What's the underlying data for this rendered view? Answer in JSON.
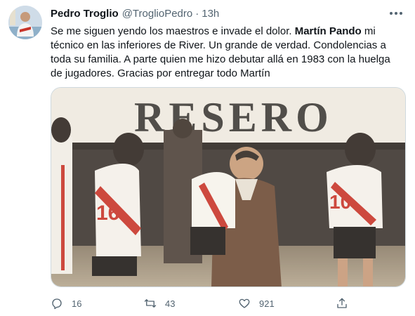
{
  "tweet": {
    "author": {
      "name": "Pedro Troglio",
      "handle": "@TroglioPedro",
      "time": "13h"
    },
    "text": {
      "intro": "Se me siguen yendo los maestros e invade el dolor. ",
      "highlight": "Martín Pando",
      "rest": " mi técnico en las inferiores de River. Un grande de verdad. Condolencias a toda su familia. A parte quien me hizo debutar allá en 1983 con la huelga de jugadores. Gracias por entregar todo Martín"
    },
    "photo": {
      "sign_text": "RESERO",
      "shirt_numbers": [
        "16",
        "10"
      ]
    },
    "stats": {
      "replies": "16",
      "retweets": "43",
      "likes": "921"
    }
  },
  "icons": [
    "avatar",
    "more-icon",
    "reply-icon",
    "retweet-icon",
    "like-icon",
    "share-icon"
  ],
  "colors": {
    "text_primary": "#0f1419",
    "text_secondary": "#536471",
    "border": "#cfd9de",
    "river_red": "#c8342a"
  }
}
